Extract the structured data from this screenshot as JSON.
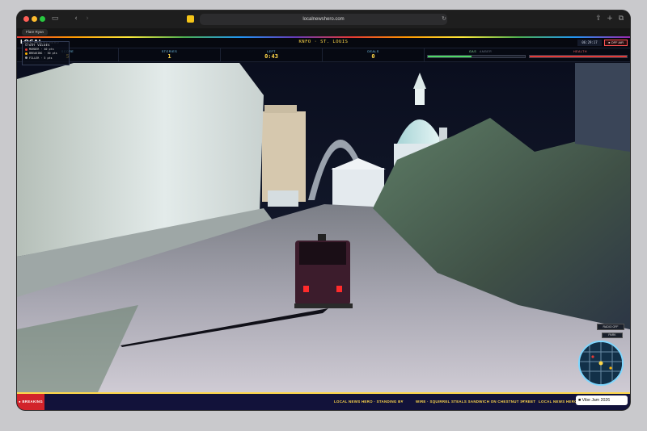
{
  "browser": {
    "url": "localnewshero.com",
    "tab_label": "Flare Ryan"
  },
  "game": {
    "logo": "LOCAL",
    "logo_sub": "NEWS HERO",
    "station": "KNFO · ST. LOUIS",
    "clock": "06:29:17",
    "off_air": "● OFF AIR",
    "stats": [
      {
        "label": "SCORE",
        "value": "5"
      },
      {
        "label": "STORIES",
        "value": "1"
      },
      {
        "label": "LEFT",
        "value": "0:43"
      },
      {
        "label": "DEALS",
        "value": "0"
      }
    ],
    "bars": {
      "gas_label": "GAS",
      "gas_sub": "AMBER",
      "gas_level": 0.45,
      "health_label": "HEALTH",
      "health_level": 1.0
    },
    "legend": {
      "title": "STORY VALUES",
      "rows": [
        {
          "color": "#e53935",
          "text": "MURDER · 40 pts"
        },
        {
          "color": "#ffb300",
          "text": "BREAKING · 30 pts"
        },
        {
          "color": "#9e9e9e",
          "text": "FILLER · 5 pts"
        }
      ]
    },
    "radio_label": "RADIO OFF",
    "park_label": "PARK",
    "ticker": {
      "breaking": "● BREAKING",
      "items": [
        "LOCAL NEWS HERO · STANDING BY",
        "•",
        "WIRE · SQUIRREL STEALS SANDWICH ON CHESTNUT STREET",
        "•",
        "LOCAL NEWS HERO · S"
      ]
    },
    "vibe_badge": "Vibe Jam 2026"
  }
}
